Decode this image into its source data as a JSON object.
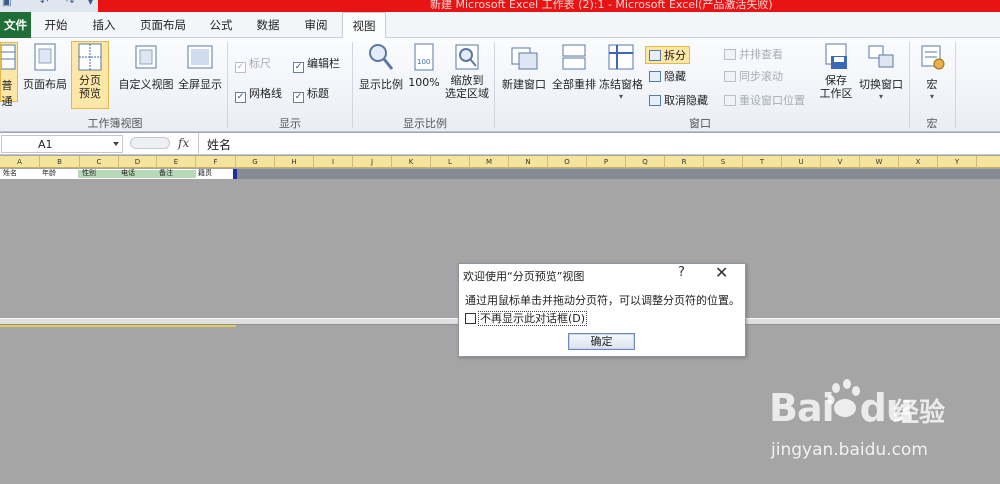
{
  "titlebar": {
    "title": "新建 Microsoft Excel 工作表 (2):1 - Microsoft Excel(产品激活失败)"
  },
  "tabs": [
    "文件",
    "开始",
    "插入",
    "页面布局",
    "公式",
    "数据",
    "审阅",
    "视图"
  ],
  "ribbon": {
    "workbook_views": {
      "normal": "普通",
      "page_layout": "页面布局",
      "page_break_preview": "分页\n预览",
      "custom_views": "自定义视图",
      "full_screen": "全屏显示",
      "label": "工作簿视图"
    },
    "show": {
      "ruler": "标尺",
      "formula_bar": "编辑栏",
      "gridlines": "网格线",
      "headings": "标题",
      "label": "显示"
    },
    "zoom": {
      "zoom": "显示比例",
      "hundred": "100%",
      "zoom_selection": "缩放到\n选定区域",
      "label": "显示比例"
    },
    "window": {
      "new_window": "新建窗口",
      "arrange_all": "全部重排",
      "freeze_panes": "冻结窗格",
      "split": "拆分",
      "hide": "隐藏",
      "unhide": "取消隐藏",
      "side_by_side": "并排查看",
      "sync_scroll": "同步滚动",
      "reset_position": "重设窗口位置",
      "save_workspace": "保存\n工作区",
      "switch_windows": "切换窗口",
      "label": "窗口"
    },
    "macros": {
      "macros": "宏",
      "label": "宏"
    }
  },
  "formula_bar": {
    "name_box": "A1",
    "fx": "fx",
    "value": "姓名"
  },
  "columns": [
    "A",
    "B",
    "C",
    "D",
    "E",
    "F",
    "G",
    "H",
    "I",
    "J",
    "K",
    "L",
    "M",
    "N",
    "O",
    "P",
    "Q",
    "R",
    "S",
    "T",
    "U",
    "V",
    "W",
    "X",
    "Y"
  ],
  "data_row": [
    "姓名",
    "年龄",
    "性别",
    "电话",
    "备注",
    "籍贯"
  ],
  "dialog": {
    "title": "欢迎使用“分页预览”视图",
    "help": "?",
    "close": "✕",
    "message": "通过用鼠标单击并拖动分页符，可以调整分页符的位置。",
    "checkbox_label": "不再显示此对话框(D)",
    "ok": "确定"
  },
  "watermark": {
    "brand": "Bai",
    "brand2": "du",
    "suffix": "经验",
    "url": "jingyan.baidu.com"
  }
}
